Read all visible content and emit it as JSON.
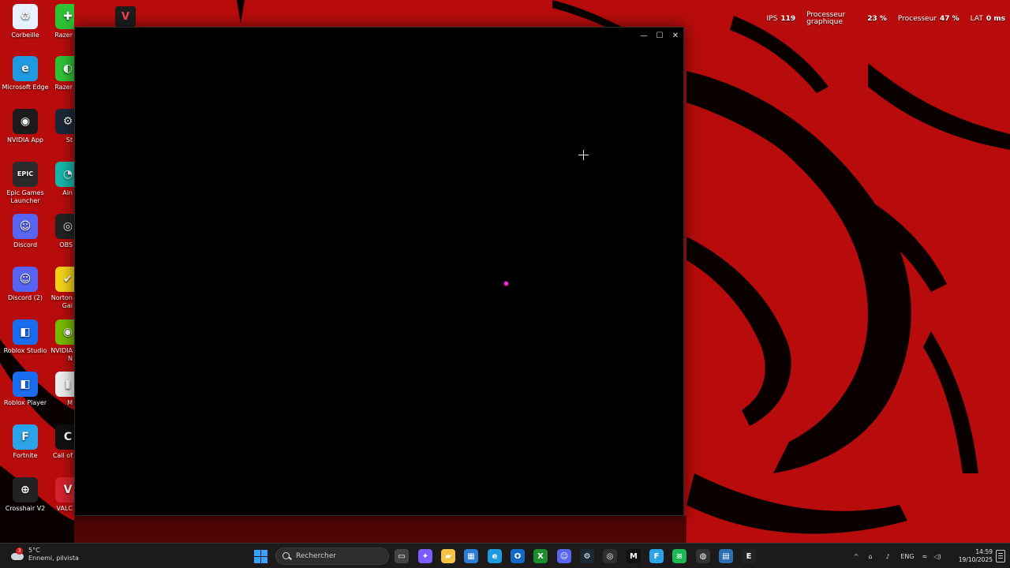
{
  "desktop": {
    "icons_col1": [
      {
        "label": "Corbeille",
        "icon": "recycle-bin-icon",
        "color": "#e8f1ff",
        "glyph": "♻"
      },
      {
        "label": "Microsoft Edge",
        "icon": "edge-icon",
        "color": "#1e9be0",
        "glyph": "e"
      },
      {
        "label": "NVIDIA App",
        "icon": "nvidia-icon",
        "color": "#1b1b1b",
        "glyph": "◉"
      },
      {
        "label": "Epic Games Launcher",
        "icon": "epic-games-icon",
        "color": "#2a2a2a",
        "glyph": "EPIC"
      },
      {
        "label": "Discord",
        "icon": "discord-icon",
        "color": "#5865f2",
        "glyph": "☺"
      },
      {
        "label": "Discord (2)",
        "icon": "discord-icon",
        "color": "#5865f2",
        "glyph": "☺"
      },
      {
        "label": "Roblox Studio",
        "icon": "roblox-studio-icon",
        "color": "#1a6cf0",
        "glyph": "◧"
      },
      {
        "label": "Roblox Player",
        "icon": "roblox-player-icon",
        "color": "#1a6cf0",
        "glyph": "◧"
      },
      {
        "label": "Fortnite",
        "icon": "fortnite-icon",
        "color": "#2aa3e8",
        "glyph": "F"
      },
      {
        "label": "Crosshair V2",
        "icon": "crosshair-app-icon",
        "color": "#222222",
        "glyph": "⊕"
      }
    ],
    "icons_col2": [
      {
        "label": "Razer",
        "icon": "razer-icon",
        "color": "#2fc235",
        "glyph": "✚"
      },
      {
        "label": "Razer",
        "icon": "razer-icon",
        "color": "#2fc235",
        "glyph": "◐"
      },
      {
        "label": "St",
        "icon": "steam-icon",
        "color": "#1b2838",
        "glyph": "⚙"
      },
      {
        "label": "Ain",
        "icon": "app-icon",
        "color": "#16b5a8",
        "glyph": "◔"
      },
      {
        "label": "OBS",
        "icon": "obs-icon",
        "color": "#222222",
        "glyph": "◎"
      },
      {
        "label": "Norton Gai",
        "icon": "norton-icon",
        "color": "#f2d21a",
        "glyph": "✔"
      },
      {
        "label": "NVIDIA N",
        "icon": "nvidia-icon",
        "color": "#76b900",
        "glyph": "◉"
      },
      {
        "label": "M",
        "icon": "app-icon",
        "color": "#eeeeee",
        "glyph": "▮"
      },
      {
        "label": "Call of",
        "icon": "call-of-duty-icon",
        "color": "#111111",
        "glyph": "C"
      },
      {
        "label": "VALC",
        "icon": "valorant-icon",
        "color": "#d4232e",
        "glyph": "V"
      }
    ]
  },
  "perf_overlay": {
    "fps_label": "IPS",
    "fps_value": "119",
    "gpu_label_1": "Processeur",
    "gpu_label_2": "graphique",
    "gpu_value": "23 %",
    "cpu_label": "Processeur",
    "cpu_value": "47 %",
    "lat_label": "LAT",
    "lat_value": "0 ms"
  },
  "window": {
    "minimize_glyph": "—",
    "maximize_glyph": "☐",
    "close_glyph": "✕"
  },
  "taskbar": {
    "weather_badge": "3",
    "weather_temp": "5°C",
    "weather_text": "Ennemi, pilvista",
    "search_placeholder": "Rechercher",
    "tray_lang": "ENG",
    "clock_time": "14:59",
    "clock_date": "19/10/2025",
    "apps": [
      {
        "name": "task-view-icon",
        "color": "#444444",
        "glyph": "▭"
      },
      {
        "name": "copilot-icon",
        "color": "#7b5cff",
        "glyph": "✦"
      },
      {
        "name": "file-explorer-icon",
        "color": "#f5c342",
        "glyph": "▰"
      },
      {
        "name": "store-icon",
        "color": "#2b7cd6",
        "glyph": "▦"
      },
      {
        "name": "edge-icon",
        "color": "#1e9be0",
        "glyph": "e"
      },
      {
        "name": "outlook-icon",
        "color": "#1269c7",
        "glyph": "O"
      },
      {
        "name": "xbox-icon",
        "color": "#1d8f2a",
        "glyph": "X"
      },
      {
        "name": "discord-icon",
        "color": "#5865f2",
        "glyph": "☺"
      },
      {
        "name": "steam-icon",
        "color": "#1b2838",
        "glyph": "⚙"
      },
      {
        "name": "obs-icon",
        "color": "#303030",
        "glyph": "◎"
      },
      {
        "name": "capcut-icon",
        "color": "#111111",
        "glyph": "M"
      },
      {
        "name": "fortnite-icon",
        "color": "#2aa3e8",
        "glyph": "F"
      },
      {
        "name": "spotify-icon",
        "color": "#1db954",
        "glyph": "≋"
      },
      {
        "name": "chrome-icon",
        "color": "#333333",
        "glyph": "◍"
      },
      {
        "name": "app-icon",
        "color": "#2a6fb0",
        "glyph": "▤"
      },
      {
        "name": "epic-games-icon",
        "color": "#222222",
        "glyph": "E"
      }
    ]
  }
}
